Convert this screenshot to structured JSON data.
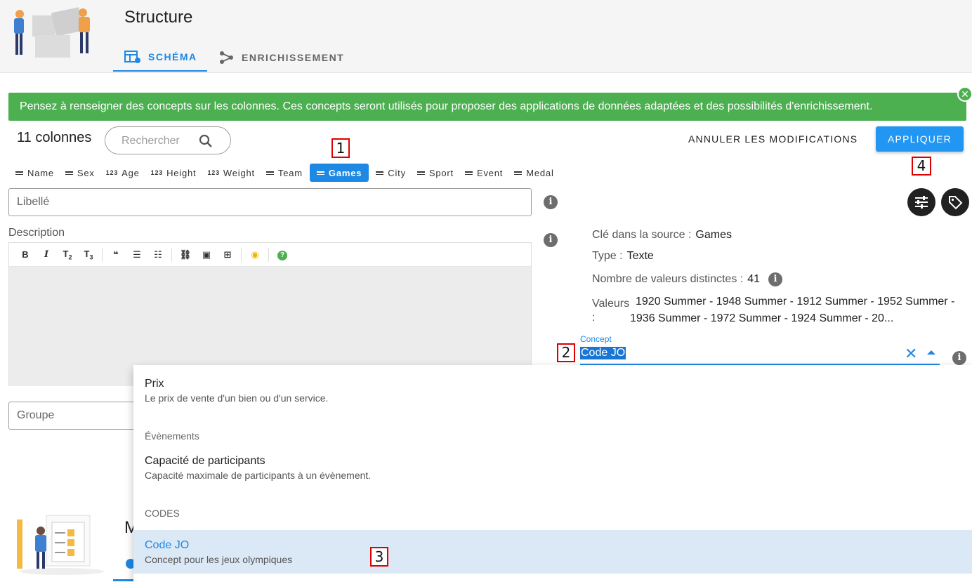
{
  "header": {
    "title": "Structure",
    "tabs": [
      {
        "label": "SCHÉMA",
        "icon": "table-edit-icon",
        "active": true
      },
      {
        "label": "ENRICHISSEMENT",
        "icon": "graph-icon",
        "active": false
      }
    ]
  },
  "alert": {
    "message": "Pensez à renseigner des concepts sur les colonnes. Ces concepts seront utilisés pour proposer des applications de données adaptées et des possibilités d'enrichissement.",
    "close_icon": "close-circle-icon",
    "color": "#4caf50"
  },
  "toolbar": {
    "column_count": "11 colonnes",
    "search_placeholder": "Rechercher",
    "cancel_label": "ANNULER LES MODIFICATIONS",
    "apply_label": "APPLIQUER"
  },
  "columns": [
    {
      "label": "Name",
      "type": "text"
    },
    {
      "label": "Sex",
      "type": "text"
    },
    {
      "label": "Age",
      "type": "number"
    },
    {
      "label": "Height",
      "type": "number"
    },
    {
      "label": "Weight",
      "type": "number"
    },
    {
      "label": "Team",
      "type": "text"
    },
    {
      "label": "Games",
      "type": "text",
      "active": true
    },
    {
      "label": "City",
      "type": "text"
    },
    {
      "label": "Sport",
      "type": "text"
    },
    {
      "label": "Event",
      "type": "text"
    },
    {
      "label": "Medal",
      "type": "text"
    }
  ],
  "number_type_glyph": "123",
  "form": {
    "libelle_placeholder": "Libellé",
    "description_label": "Description",
    "groupe_placeholder": "Groupe",
    "editor_tools": [
      "B",
      "I",
      "T2",
      "T3",
      "quote",
      "bullet-list",
      "numbered-list",
      "link",
      "image",
      "table",
      "preview",
      "help"
    ]
  },
  "details": {
    "key_label": "Clé dans la source :",
    "key_value": "Games",
    "type_label": "Type :",
    "type_value": "Texte",
    "distinct_label": "Nombre de valeurs distinctes :",
    "distinct_value": "41",
    "values_label": "Valeurs :",
    "values_text": "1920 Summer - 1948 Summer - 1912 Summer - 1952 Summer - 1936 Summer - 1972 Summer - 1924 Summer - 20..."
  },
  "concept": {
    "label": "Concept",
    "value": "Code JO",
    "clear_icon": "close-icon",
    "arrow_icon": "caret-up-icon"
  },
  "menu": {
    "items": [
      {
        "kind": "item",
        "title": "Prix",
        "subtitle": "Le prix de vente d'un bien ou d'un service."
      },
      {
        "kind": "header",
        "title": "Évènements"
      },
      {
        "kind": "item",
        "title": "Capacité de participants",
        "subtitle": "Capacité maximale de participants à un évènement."
      },
      {
        "kind": "header",
        "title": "CODES"
      },
      {
        "kind": "item",
        "title": "Code JO",
        "subtitle": "Concept pour les jeux olympiques",
        "selected": true
      }
    ]
  },
  "bottom": {
    "title_partial": "M"
  },
  "markers": [
    "1",
    "2",
    "3",
    "4"
  ]
}
